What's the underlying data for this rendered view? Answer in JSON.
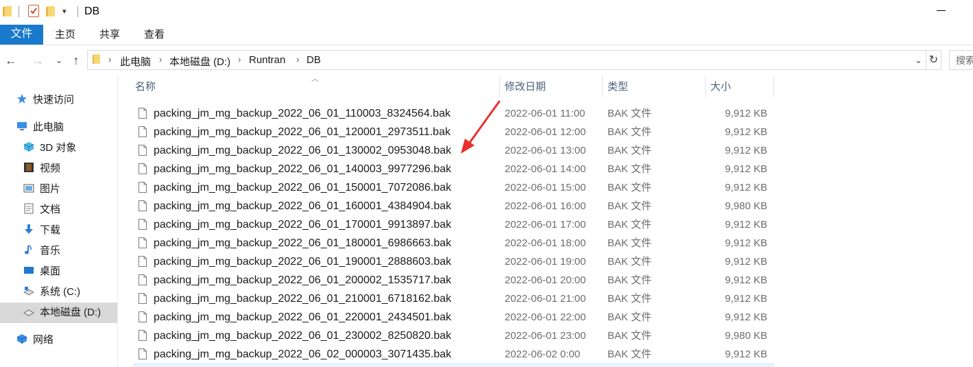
{
  "window": {
    "title": "DB"
  },
  "ribbon": {
    "tabs": [
      {
        "label": "文件",
        "active": true
      },
      {
        "label": "主页"
      },
      {
        "label": "共享"
      },
      {
        "label": "查看"
      }
    ]
  },
  "address": {
    "crumbs": [
      "此电脑",
      "本地磁盘 (D:)",
      "Runtran",
      "DB"
    ],
    "search_placeholder": "搜索\"DB\""
  },
  "sidebar": {
    "quick_access": "快速访问",
    "this_pc": "此电脑",
    "items": [
      {
        "label": "3D 对象",
        "icon": "3d-objects-icon"
      },
      {
        "label": "视频",
        "icon": "video-icon"
      },
      {
        "label": "图片",
        "icon": "pictures-icon"
      },
      {
        "label": "文档",
        "icon": "documents-icon"
      },
      {
        "label": "下载",
        "icon": "download-icon"
      },
      {
        "label": "音乐",
        "icon": "music-icon"
      },
      {
        "label": "桌面",
        "icon": "desktop-icon"
      },
      {
        "label": "系统 (C:)",
        "icon": "drive-c-icon"
      },
      {
        "label": "本地磁盘 (D:)",
        "icon": "drive-d-icon",
        "selected": true
      }
    ],
    "network": "网络"
  },
  "columns": {
    "name": "名称",
    "date": "修改日期",
    "type": "类型",
    "size": "大小"
  },
  "files": [
    {
      "name": "packing_jm_mg_backup_2022_06_01_110003_8324564.bak",
      "date": "2022-06-01 11:00",
      "type": "BAK 文件",
      "size": "9,912 KB"
    },
    {
      "name": "packing_jm_mg_backup_2022_06_01_120001_2973511.bak",
      "date": "2022-06-01 12:00",
      "type": "BAK 文件",
      "size": "9,912 KB"
    },
    {
      "name": "packing_jm_mg_backup_2022_06_01_130002_0953048.bak",
      "date": "2022-06-01 13:00",
      "type": "BAK 文件",
      "size": "9,912 KB"
    },
    {
      "name": "packing_jm_mg_backup_2022_06_01_140003_9977296.bak",
      "date": "2022-06-01 14:00",
      "type": "BAK 文件",
      "size": "9,912 KB"
    },
    {
      "name": "packing_jm_mg_backup_2022_06_01_150001_7072086.bak",
      "date": "2022-06-01 15:00",
      "type": "BAK 文件",
      "size": "9,912 KB"
    },
    {
      "name": "packing_jm_mg_backup_2022_06_01_160001_4384904.bak",
      "date": "2022-06-01 16:00",
      "type": "BAK 文件",
      "size": "9,980 KB"
    },
    {
      "name": "packing_jm_mg_backup_2022_06_01_170001_9913897.bak",
      "date": "2022-06-01 17:00",
      "type": "BAK 文件",
      "size": "9,912 KB"
    },
    {
      "name": "packing_jm_mg_backup_2022_06_01_180001_6986663.bak",
      "date": "2022-06-01 18:00",
      "type": "BAK 文件",
      "size": "9,912 KB"
    },
    {
      "name": "packing_jm_mg_backup_2022_06_01_190001_2888603.bak",
      "date": "2022-06-01 19:00",
      "type": "BAK 文件",
      "size": "9,912 KB"
    },
    {
      "name": "packing_jm_mg_backup_2022_06_01_200002_1535717.bak",
      "date": "2022-06-01 20:00",
      "type": "BAK 文件",
      "size": "9,912 KB"
    },
    {
      "name": "packing_jm_mg_backup_2022_06_01_210001_6718162.bak",
      "date": "2022-06-01 21:00",
      "type": "BAK 文件",
      "size": "9,912 KB"
    },
    {
      "name": "packing_jm_mg_backup_2022_06_01_220001_2434501.bak",
      "date": "2022-06-01 22:00",
      "type": "BAK 文件",
      "size": "9,912 KB"
    },
    {
      "name": "packing_jm_mg_backup_2022_06_01_230002_8250820.bak",
      "date": "2022-06-01 23:00",
      "type": "BAK 文件",
      "size": "9,980 KB"
    },
    {
      "name": "packing_jm_mg_backup_2022_06_02_000003_3071435.bak",
      "date": "2022-06-02 0:00",
      "type": "BAK 文件",
      "size": "9,912 KB"
    }
  ],
  "colors": {
    "accent": "#1979ca",
    "annotation": "#e8312f",
    "selected_bg": "#d9d9d9"
  }
}
